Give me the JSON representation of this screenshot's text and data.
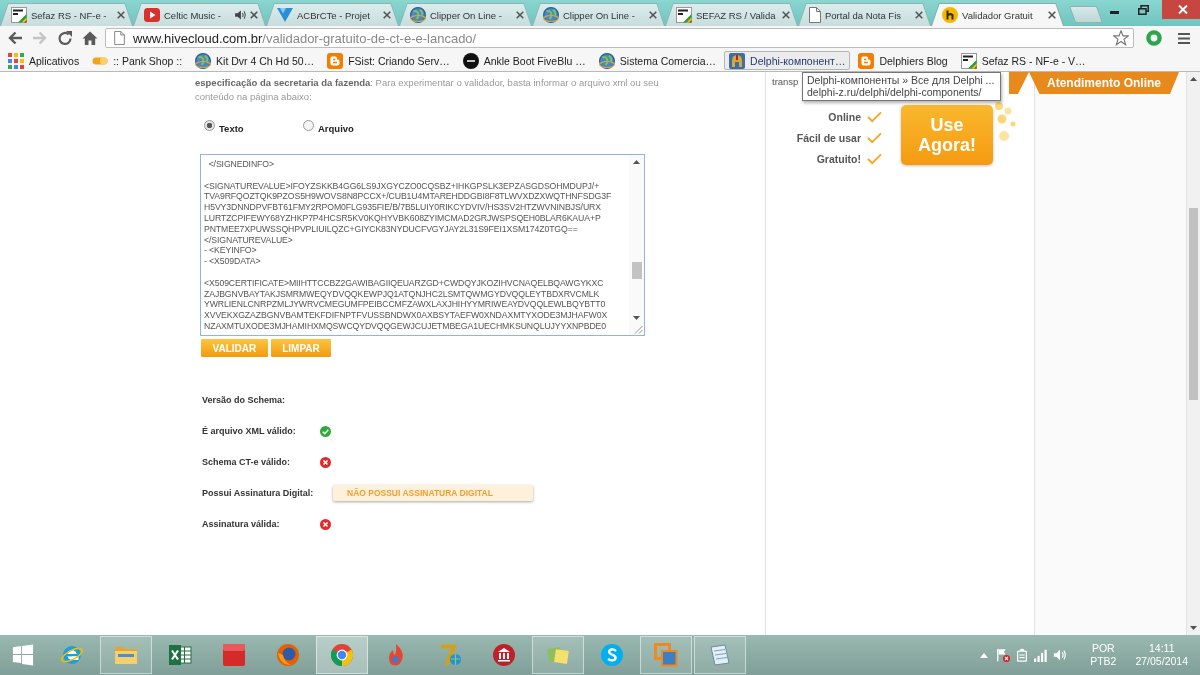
{
  "browser": {
    "tabs": [
      {
        "title": "Sefaz RS - NF-e -",
        "kind": "sefaz",
        "audio": false,
        "selected": false
      },
      {
        "title": "Celtic Music -",
        "kind": "video",
        "audio": true,
        "selected": false
      },
      {
        "title": "ACBrCTe - Projet",
        "kind": "triangle",
        "audio": false,
        "selected": false
      },
      {
        "title": "Clipper On Line -",
        "kind": "globe",
        "audio": false,
        "selected": false
      },
      {
        "title": "Clipper On Line -",
        "kind": "globe",
        "audio": false,
        "selected": false
      },
      {
        "title": "SEFAZ RS / Valida",
        "kind": "sefaz",
        "audio": false,
        "selected": false
      },
      {
        "title": "Portal da Nota Fis",
        "kind": "page",
        "audio": false,
        "selected": false
      },
      {
        "title": "Validador Gratuit",
        "kind": "hive",
        "audio": false,
        "selected": true
      }
    ],
    "nav": [
      {
        "kind": "back",
        "disabled": false
      },
      {
        "kind": "forward",
        "disabled": true
      },
      {
        "kind": "reload",
        "disabled": false
      },
      {
        "kind": "home",
        "disabled": false
      }
    ],
    "address": {
      "host": "www.hivecloud.com.br",
      "path": "/validador-gratuito-de-ct-e-e-lancado/",
      "starred": false
    },
    "bookmarks": [
      {
        "label": "Aplicativos",
        "kind": "apps",
        "hovered": false
      },
      {
        "label": ":: Pank Shop ::",
        "kind": "pill",
        "hovered": false
      },
      {
        "label": "Kit Dvr 4 Ch Hd 50…",
        "kind": "globe",
        "hovered": false
      },
      {
        "label": "FSist: Criando Serv…",
        "kind": "blog",
        "hovered": false
      },
      {
        "label": "Ankle Boot FiveBlu …",
        "kind": "disc",
        "hovered": false
      },
      {
        "label": "Sistema Comercia…",
        "kind": "globe",
        "hovered": false
      },
      {
        "label": "Delphi-компонент…",
        "kind": "helmet",
        "hovered": true
      },
      {
        "label": "Delphiers Blog",
        "kind": "blog",
        "hovered": false
      },
      {
        "label": "Sefaz RS - NF-e - V…",
        "kind": "sefaz",
        "hovered": false
      }
    ]
  },
  "tooltip": {
    "title": "Delphi-компоненты » Все для Delphi ...",
    "url": "delphi-z.ru/delphi/delphi-components/"
  },
  "page": {
    "intro": "**especificação da secretaria da fazenda**: Para experimentar o validador, basta informar o arquivo xml ou seu conteúdo na página abaixo:",
    "input_modes": [
      {
        "label": "Texto",
        "selected": true
      },
      {
        "label": "Arquivo",
        "selected": false
      }
    ],
    "xml_input": {
      "value": "  </SIGNEDINFO>\n\n<SIGNATUREVALUE>IFOYZSKKB4GG6LS9JXGYCZO0CQSBZ+IHKGPSLK3EPZASGDSOHMDUPJ/+\nTVA9RFQOZTQK9PZOS5H9WOVS8N8PCCX+/CUB1U4MTAREHDDGBI8F8TLWVXDZXWQTHNFSDG3F\nH5VY3DNNDPVFBT61FMY2RPOM0FLG935FIE/B/7B5LUIY0RIKCYDVIV/HS3SV2HTZWVNINBJS/URX\nLURTZCPIFEWY68YZHKP7P4HCSR5KV0KQHYVBK608ZYIMCMAD2GRJWSPSQEH0BLAR6KAUA+P\nPNTMEE7XPUWSSQHPVPLIUILQZC+GIYCK83NYDUCFVGYJAY2L31S9FEI1XSM174Z0TGQ==\n</SIGNATUREVALUE>\n- <KEYINFO>\n- <X509DATA>\n\n<X509CERTIFICATE>MIIHTTCCBZ2GAWIBAGIIQEUARZGD+CWDQYJKOZIHVCNAQELBQAWGYKXC\nZAJBGNVBAYTAKJSMRMWEQYDVQQKEWPJQ1ATQNJHC2LSMTQWMGYDVQQLEYTBDXRVCMLK\nYWRLIENLCNRPZMLJYWRVCMEGUMFPEIBCCMFZAWXLAXJHIHYYMRIWEAYDVQQLEWLBQYBTT0\nXVVEKXGZAZBGNVBAMTEKFDIFNPTFVUSSBNDWX0AXBSYTAEFW0XNDAXMTYXODE3MJHAFW0X\nNZAXMTUXODE3MJHAMIHXMQSWCQYDVQQGEWJCUJETMBEGA1UECHMKSUNQLUJYYXNPBDE0"
    },
    "buttons": [
      "VALIDAR",
      "LIMPAR"
    ],
    "results": [
      {
        "label": "Versão do Schema:",
        "kind": "plain"
      },
      {
        "label": "É arquivo XML válido:",
        "kind": "status",
        "valid": true
      },
      {
        "label": "Schema CT-e válido:",
        "kind": "status",
        "valid": false
      },
      {
        "label": "Possui Assinatura Digital:",
        "kind": "badge",
        "badge": "NÃO POSSUI ASSINATURA DIGITAL"
      },
      {
        "label": "Assinatura válida:",
        "kind": "status",
        "valid": false
      }
    ]
  },
  "sidebar": {
    "cut_text": "transp",
    "features": [
      "Online",
      "Fácil de usar",
      "Gratuito!"
    ],
    "cta": "Use Agora!"
  },
  "support_banner": "Atendimento Online",
  "taskbar": {
    "apps": [
      {
        "kind": "ie",
        "running": false,
        "selected": false
      },
      {
        "kind": "explorer",
        "running": true,
        "selected": false
      },
      {
        "kind": "excel",
        "running": false,
        "selected": false
      },
      {
        "kind": "redapp",
        "running": false,
        "selected": false
      },
      {
        "kind": "firefox",
        "running": false,
        "selected": false
      },
      {
        "kind": "chrome",
        "running": true,
        "selected": true
      },
      {
        "kind": "flame",
        "running": false,
        "selected": false
      },
      {
        "kind": "seven",
        "running": false,
        "selected": false
      },
      {
        "kind": "bank",
        "running": false,
        "selected": false
      },
      {
        "kind": "notes",
        "running": true,
        "selected": false
      },
      {
        "kind": "skype",
        "running": false,
        "selected": false
      },
      {
        "kind": "stack",
        "running": true,
        "selected": false
      },
      {
        "kind": "notepad",
        "running": true,
        "selected": false
      }
    ],
    "language": [
      "POR",
      "PTB2"
    ],
    "time": "14:11",
    "date": "27/05/2014"
  }
}
